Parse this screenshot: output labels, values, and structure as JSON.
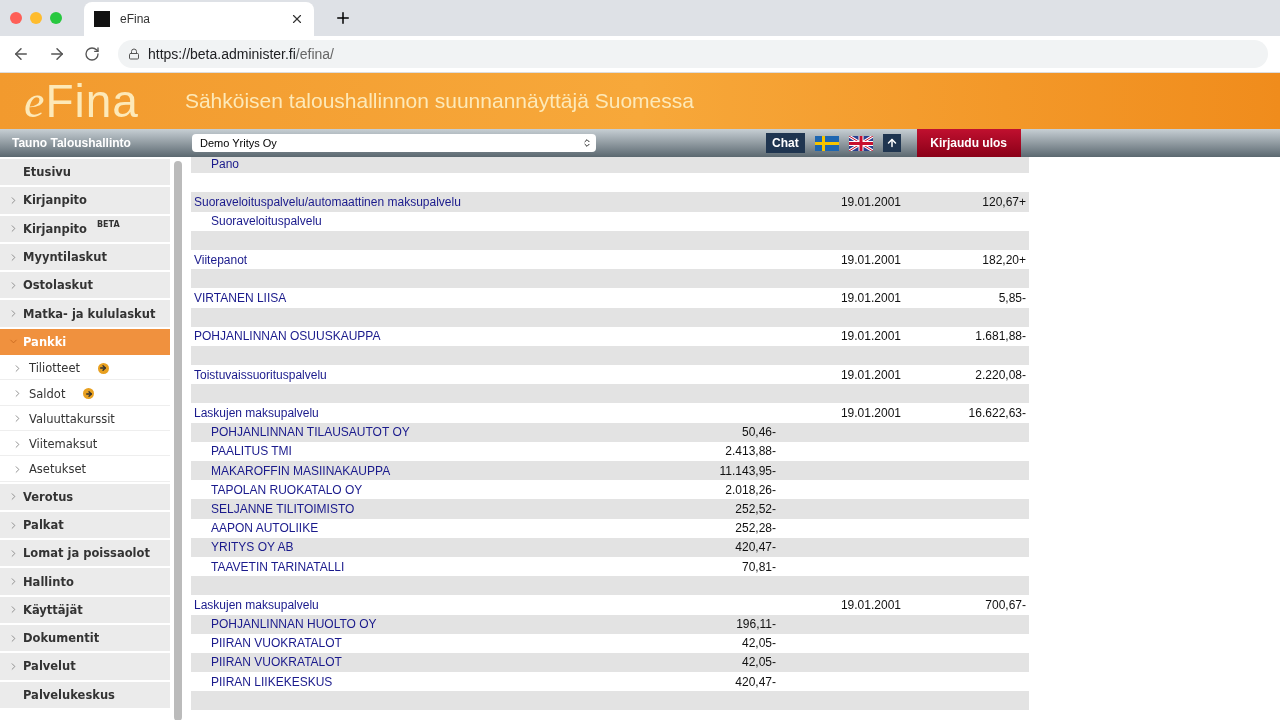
{
  "browser": {
    "tab_title": "eFina",
    "url_host": "https://beta.administer.fi",
    "url_path": "/efina/"
  },
  "banner": {
    "logo_e": "e",
    "logo_rest": "Fina",
    "slogan": "Sähköisen taloushallinnon suunnannäyttäjä Suomessa"
  },
  "toolbar": {
    "user": "Tauno Taloushallinto",
    "company": "Demo Yritys Oy",
    "chat": "Chat",
    "logout": "Kirjaudu ulos"
  },
  "sidebar": [
    {
      "label": "Etusivu",
      "kind": "plain",
      "selected": false
    },
    {
      "label": "Kirjanpito",
      "kind": "top",
      "selected": false,
      "expanded": false
    },
    {
      "label": "Kirjanpito",
      "badge": "BETA",
      "kind": "top",
      "selected": false,
      "expanded": false
    },
    {
      "label": "Myyntilaskut",
      "kind": "top",
      "selected": false,
      "expanded": false
    },
    {
      "label": "Ostolaskut",
      "kind": "top",
      "selected": false,
      "expanded": false
    },
    {
      "label": "Matka- ja kululaskut",
      "kind": "top",
      "selected": false,
      "expanded": false
    },
    {
      "label": "Pankki",
      "kind": "top",
      "selected": true,
      "expanded": true,
      "children": [
        {
          "label": "Tiliotteet",
          "notice": true
        },
        {
          "label": "Saldot",
          "notice": true
        },
        {
          "label": "Valuuttakurssit",
          "notice": false
        },
        {
          "label": "Viitemaksut",
          "notice": false
        },
        {
          "label": "Asetukset",
          "notice": false
        }
      ]
    },
    {
      "label": "Verotus",
      "kind": "top",
      "selected": false,
      "expanded": false
    },
    {
      "label": "Palkat",
      "kind": "top",
      "selected": false,
      "expanded": false
    },
    {
      "label": "Lomat ja poissaolot",
      "kind": "top",
      "selected": false,
      "expanded": false
    },
    {
      "label": "Hallinto",
      "kind": "top",
      "selected": false,
      "expanded": false
    },
    {
      "label": "Käyttäjät",
      "kind": "top",
      "selected": false,
      "expanded": false
    },
    {
      "label": "Dokumentit",
      "kind": "top",
      "selected": false,
      "expanded": false
    },
    {
      "label": "Palvelut",
      "kind": "top",
      "selected": false,
      "expanded": false
    },
    {
      "label": "Palvelukeskus",
      "kind": "plain",
      "selected": false
    }
  ],
  "rows": [
    {
      "kind": "sub",
      "name": "Pano"
    },
    {
      "kind": "blank"
    },
    {
      "kind": "main",
      "name": "Suoraveloituspalvelu/automaattinen maksupalvelu",
      "date": "19.01.2001",
      "amount": "120,67+"
    },
    {
      "kind": "sub",
      "name": "Suoraveloituspalvelu"
    },
    {
      "kind": "blank"
    },
    {
      "kind": "main",
      "name": "Viitepanot",
      "date": "19.01.2001",
      "amount": "182,20+"
    },
    {
      "kind": "blank"
    },
    {
      "kind": "main",
      "name": "VIRTANEN LIISA",
      "date": "19.01.2001",
      "amount": "5,85-"
    },
    {
      "kind": "blank"
    },
    {
      "kind": "main",
      "name": "POHJANLINNAN OSUUSKAUPPA",
      "date": "19.01.2001",
      "amount": "1.681,88-"
    },
    {
      "kind": "blank"
    },
    {
      "kind": "main",
      "name": "Toistuvaissuorituspalvelu",
      "date": "19.01.2001",
      "amount": "2.220,08-"
    },
    {
      "kind": "blank"
    },
    {
      "kind": "main",
      "name": "Laskujen maksupalvelu",
      "date": "19.01.2001",
      "amount": "16.622,63-"
    },
    {
      "kind": "sub",
      "name": "POHJANLINNAN TILAUSAUTOT OY",
      "amount": "50,46-"
    },
    {
      "kind": "sub",
      "name": "PAALITUS TMI",
      "amount": "2.413,88-"
    },
    {
      "kind": "sub",
      "name": "MAKAROFFIN MASIINAKAUPPA",
      "amount": "11.143,95-"
    },
    {
      "kind": "sub",
      "name": "TAPOLAN RUOKATALO OY",
      "amount": "2.018,26-"
    },
    {
      "kind": "sub",
      "name": "SELJANNE TILITOIMISTO",
      "amount": "252,52-"
    },
    {
      "kind": "sub",
      "name": "AAPON AUTOLIIKE",
      "amount": "252,28-"
    },
    {
      "kind": "sub",
      "name": "YRITYS OY AB",
      "amount": "420,47-"
    },
    {
      "kind": "sub",
      "name": "TAAVETIN TARINATALLI",
      "amount": "70,81-"
    },
    {
      "kind": "blank"
    },
    {
      "kind": "main",
      "name": "Laskujen maksupalvelu",
      "date": "19.01.2001",
      "amount": "700,67-"
    },
    {
      "kind": "sub",
      "name": "POHJANLINNAN HUOLTO OY",
      "amount": "196,11-"
    },
    {
      "kind": "sub",
      "name": "PIIRAN VUOKRATALOT",
      "amount": "42,05-"
    },
    {
      "kind": "sub",
      "name": "PIIRAN VUOKRATALOT",
      "amount": "42,05-"
    },
    {
      "kind": "sub",
      "name": "PIIRAN LIIKEKESKUS",
      "amount": "420,47-"
    },
    {
      "kind": "blank"
    }
  ]
}
